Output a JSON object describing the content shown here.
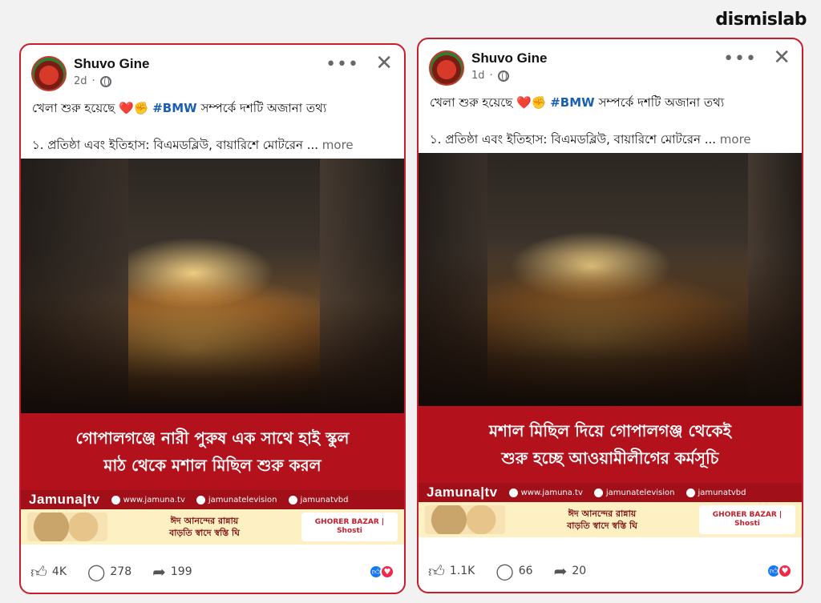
{
  "brand": "dismislab",
  "posts": [
    {
      "author": "Shuvo Gine",
      "time": "2d",
      "line1_prefix": "খেলা শুরু হয়েছে",
      "emoji": "❤️✊",
      "hashtag": "#BMW",
      "line1_suffix": "সম্পর্কে দশটি অজানা তথ্য",
      "line2": "১. প্রতিষ্ঠা এবং ইতিহাস: বিএমডব্লিউ, বায়ারিশে মোটরেন ...",
      "more": "more",
      "caption_line1": "গোপালগঞ্জে নারী পুরুষ এক সাথে হাই স্কুল",
      "caption_line2": "মাঠ থেকে মশাল মিছিল শুরু করল",
      "channel": "Jamuna|tv",
      "web": "www.jamuna.tv",
      "facebook": "jamunatelevision",
      "youtube": "jamunatvbd",
      "ad_text_1": "ঈদ আনন্দের রান্নায়",
      "ad_text_2": "বাড়তি স্বাদে স্বস্তি ঘি",
      "ad_brand": "GHORER BAZAR | Shosti",
      "likes": "4K",
      "comments": "278",
      "shares": "199"
    },
    {
      "author": "Shuvo Gine",
      "time": "1d",
      "line1_prefix": "খেলা শুরু হয়েছে",
      "emoji": "❤️✊",
      "hashtag": "#BMW",
      "line1_suffix": "সম্পর্কে দশটি অজানা তথ্য",
      "line2": "১. প্রতিষ্ঠা এবং ইতিহাস: বিএমডব্লিউ, বায়ারিশে মোটরেন ...",
      "more": "more",
      "caption_line1": "মশাল মিছিল দিয়ে গোপালগঞ্জ থেকেই",
      "caption_line2": "শুরু হচ্ছে আওয়ামীলীগের কর্মসূচি",
      "channel": "Jamuna|tv",
      "web": "www.jamuna.tv",
      "facebook": "jamunatelevision",
      "youtube": "jamunatvbd",
      "ad_text_1": "ঈদ আনন্দের রান্নায়",
      "ad_text_2": "বাড়তি স্বাদে স্বস্তি ঘি",
      "ad_brand": "GHORER BAZAR | Shosti",
      "likes": "1.1K",
      "comments": "66",
      "shares": "20"
    }
  ],
  "colors": {
    "accent": "#c81e2b",
    "caption_bg": "#b3121d",
    "hashtag": "#1a5fb4"
  }
}
